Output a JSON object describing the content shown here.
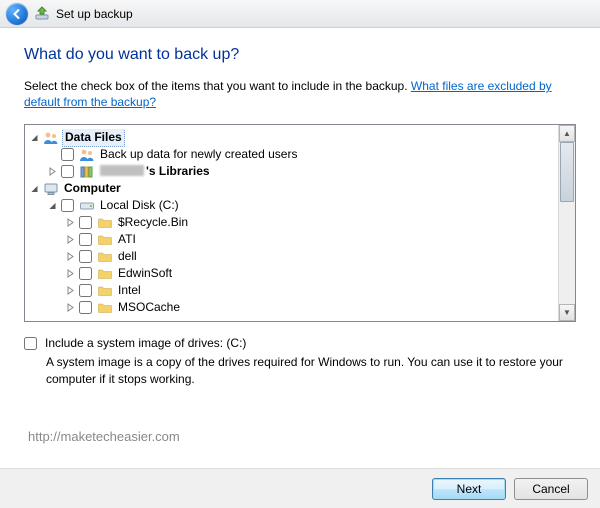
{
  "title": "Set up backup",
  "heading": "What do you want to back up?",
  "instruction_prefix": "Select the check box of the items that you want to include in the backup. ",
  "help_link": "What files are excluded by default from the backup?",
  "tree": {
    "data_files": "Data Files",
    "backup_new_users": "Back up data for newly created users",
    "user_libraries_suffix": "'s Libraries",
    "computer": "Computer",
    "local_disk": "Local Disk (C:)",
    "folders": [
      "$Recycle.Bin",
      "ATI",
      "dell",
      "EdwinSoft",
      "Intel",
      "MSOCache"
    ]
  },
  "include_image_label": "Include a system image of drives: (C:)",
  "include_image_desc": "A system image is a copy of the drives required for Windows to run. You can use it to restore your computer if it stops working.",
  "watermark": "http://maketecheasier.com",
  "buttons": {
    "next": "Next",
    "cancel": "Cancel"
  }
}
